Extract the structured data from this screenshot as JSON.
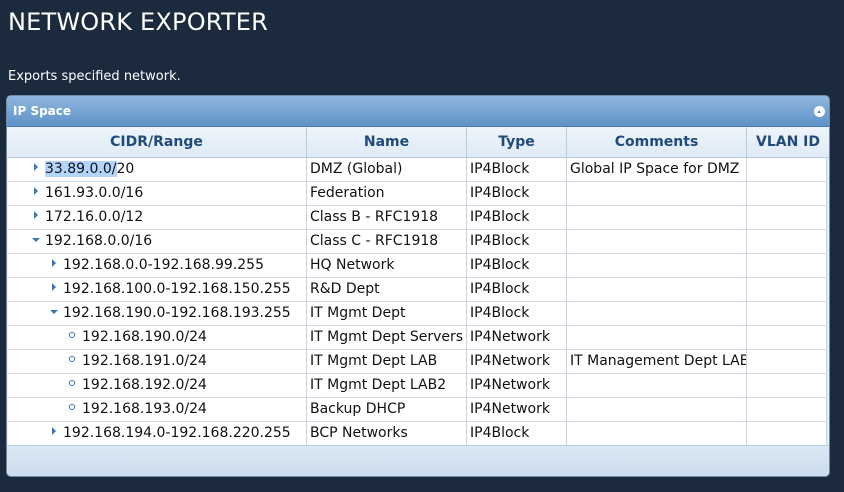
{
  "page": {
    "title": "NETWORK EXPORTER",
    "description": "Exports specified network."
  },
  "panel": {
    "title": "IP Space",
    "collapse_icon": "collapse-up-icon"
  },
  "columns": {
    "cidr": "CIDR/Range",
    "name": "Name",
    "type": "Type",
    "comments": "Comments",
    "vlan": "VLAN ID"
  },
  "colors": {
    "background": "#1c2a3d",
    "header_accent": "#5f93c8",
    "column_header_text": "#1f4a7a",
    "selection": "#b3d4fc"
  },
  "rows": [
    {
      "cidr_sel": "33.89.0.0/",
      "cidr_rest": "20",
      "name": "DMZ (Global)",
      "type": "IP4Block",
      "comments": "Global IP Space for DMZ",
      "vlan": ""
    },
    {
      "cidr": "161.93.0.0/16",
      "name": "Federation",
      "type": "IP4Block",
      "comments": "",
      "vlan": ""
    },
    {
      "cidr": "172.16.0.0/12",
      "name": "Class B - RFC1918",
      "type": "IP4Block",
      "comments": "",
      "vlan": ""
    },
    {
      "cidr": "192.168.0.0/16",
      "name": "Class C - RFC1918",
      "type": "IP4Block",
      "comments": "",
      "vlan": ""
    },
    {
      "cidr": "192.168.0.0-192.168.99.255",
      "name": "HQ Network",
      "type": "IP4Block",
      "comments": "",
      "vlan": ""
    },
    {
      "cidr": "192.168.100.0-192.168.150.255",
      "name": "R&D Dept",
      "type": "IP4Block",
      "comments": "",
      "vlan": ""
    },
    {
      "cidr": "192.168.190.0-192.168.193.255",
      "name": "IT Mgmt Dept",
      "type": "IP4Block",
      "comments": "",
      "vlan": ""
    },
    {
      "cidr": "192.168.190.0/24",
      "name": "IT Mgmt Dept Servers",
      "type": "IP4Network",
      "comments": "",
      "vlan": ""
    },
    {
      "cidr": "192.168.191.0/24",
      "name": "IT Mgmt Dept LAB",
      "type": "IP4Network",
      "comments": "IT Management Dept LAB",
      "vlan": ""
    },
    {
      "cidr": "192.168.192.0/24",
      "name": "IT Mgmt Dept LAB2",
      "type": "IP4Network",
      "comments": "",
      "vlan": ""
    },
    {
      "cidr": "192.168.193.0/24",
      "name": "Backup DHCP",
      "type": "IP4Network",
      "comments": "",
      "vlan": ""
    },
    {
      "cidr": "192.168.194.0-192.168.220.255",
      "name": "BCP Networks",
      "type": "IP4Block",
      "comments": "",
      "vlan": ""
    }
  ]
}
